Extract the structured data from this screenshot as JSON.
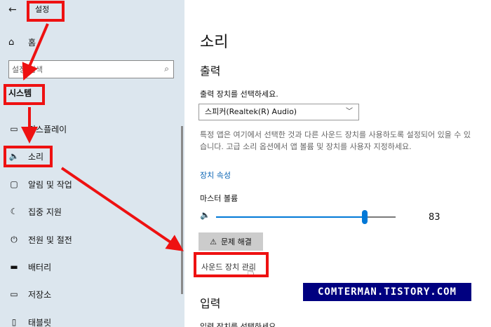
{
  "header": {
    "title": "설정",
    "back_icon": "←"
  },
  "sidebar": {
    "home": {
      "label": "홈",
      "icon": "⌂"
    },
    "search": {
      "placeholder": "설정 검색",
      "icon": "⌕"
    },
    "section_title": "시스템",
    "items": [
      {
        "label": "디스플레이",
        "icon": "▭"
      },
      {
        "label": "소리",
        "icon": "🔈"
      },
      {
        "label": "알림 및 작업",
        "icon": "▢"
      },
      {
        "label": "집중 지원",
        "icon": "☾"
      },
      {
        "label": "전원 및 절전",
        "icon": "⏻"
      },
      {
        "label": "배터리",
        "icon": "▬"
      },
      {
        "label": "저장소",
        "icon": "▭"
      },
      {
        "label": "태블릿",
        "icon": "▯"
      }
    ]
  },
  "main": {
    "title": "소리",
    "output": {
      "heading": "출력",
      "device_label": "출력 장치를 선택하세요.",
      "selected_device": "스피커(Realtek(R) Audio)",
      "description": "특정 앱은 여기에서 선택한 것과 다른 사운드 장치를 사용하도록 설정되어 있을 수 있습니다. 고급 소리 옵션에서 앱 볼륨 및 장치를 사용자 지정하세요.",
      "device_properties_link": "장치 속성",
      "master_volume_label": "마스터 볼륨",
      "volume": 83,
      "volume_display": "83",
      "troubleshoot_label": "문제 해결",
      "troubleshoot_icon": "⚠",
      "manage_devices_link": "사운드 장치 관리"
    },
    "input": {
      "heading": "입력",
      "device_label": "입력 장치를 선택하세요."
    }
  },
  "watermark": "COMTERMAN.TISTORY.COM",
  "colors": {
    "sidebar_bg": "#dce6ee",
    "accent": "#0078d7",
    "link": "#0a64b4",
    "annotation": "#ee1111",
    "watermark_bg": "#000080"
  }
}
